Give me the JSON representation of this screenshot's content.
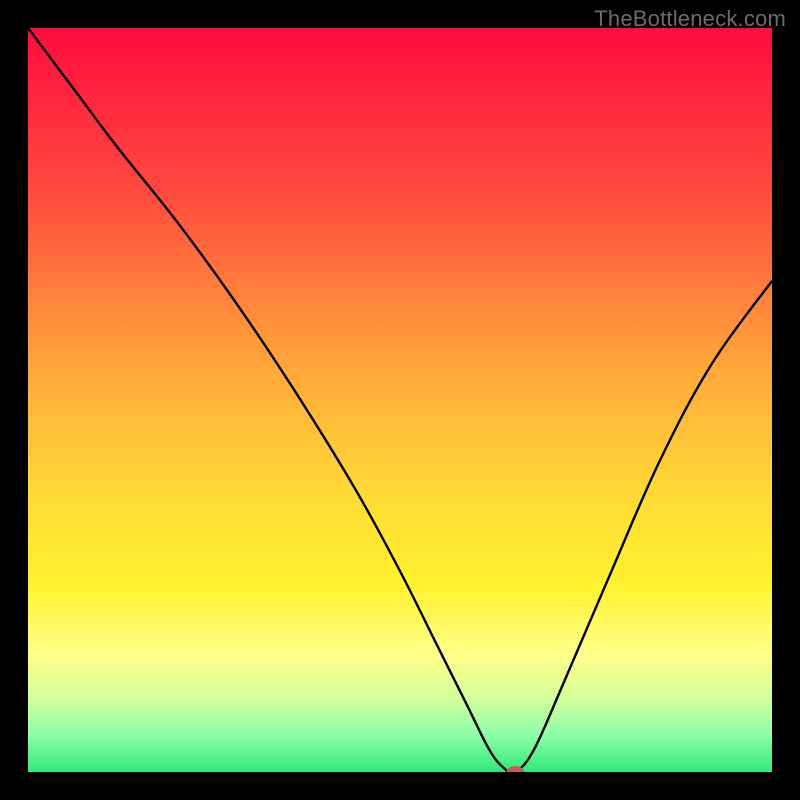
{
  "watermark": "TheBottleneck.com",
  "chart_data": {
    "type": "line",
    "title": "",
    "xlabel": "",
    "ylabel": "",
    "xlim": [
      0,
      100
    ],
    "ylim": [
      0,
      100
    ],
    "grid": false,
    "background_gradient": {
      "stops": [
        {
          "offset": 0,
          "color": "#ff0b3e"
        },
        {
          "offset": 22,
          "color": "#ff4a3e"
        },
        {
          "offset": 45,
          "color": "#ffa53a"
        },
        {
          "offset": 62,
          "color": "#ffd935"
        },
        {
          "offset": 75,
          "color": "#fff22f"
        },
        {
          "offset": 84,
          "color": "#ffff8a"
        },
        {
          "offset": 90,
          "color": "#d4ff9a"
        },
        {
          "offset": 95,
          "color": "#8cffa8"
        },
        {
          "offset": 100,
          "color": "#30e97a"
        }
      ]
    },
    "series": [
      {
        "name": "bottleneck-curve",
        "color": "#000000",
        "x": [
          0,
          6,
          12,
          20,
          28,
          36,
          44,
          50,
          55,
          59,
          62,
          64,
          65.5,
          68,
          72,
          78,
          85,
          92,
          100
        ],
        "y": [
          100,
          92,
          84,
          74,
          63,
          51,
          38,
          27,
          17,
          9,
          3,
          0.5,
          0,
          3,
          12,
          26,
          42,
          55,
          66
        ]
      }
    ],
    "marker": {
      "name": "optimal-point",
      "x": 65.5,
      "y": 0,
      "rx": 9,
      "ry": 6,
      "color": "#c85a5a"
    }
  }
}
